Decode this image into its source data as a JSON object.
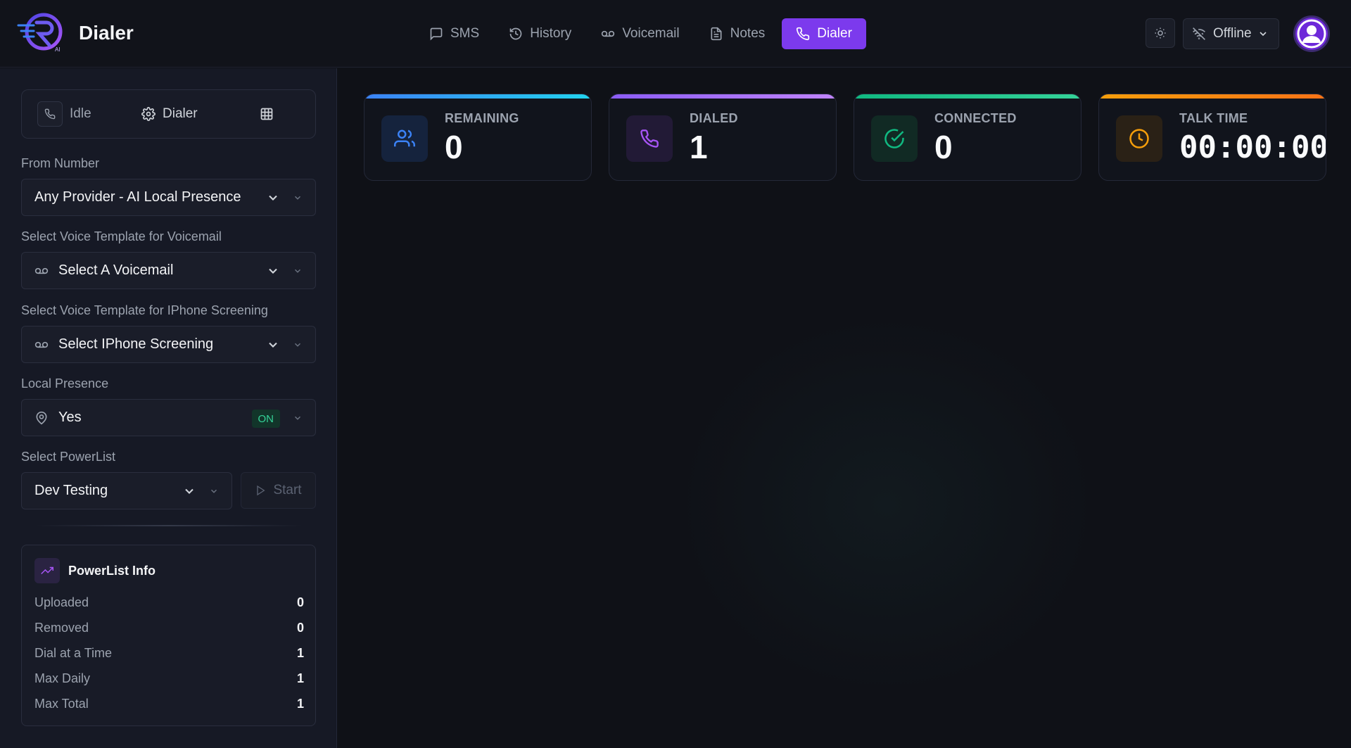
{
  "app": {
    "title": "Dialer",
    "accent": "#7c3aed"
  },
  "nav": {
    "items": [
      {
        "label": "SMS",
        "icon": "message-icon"
      },
      {
        "label": "History",
        "icon": "history-icon"
      },
      {
        "label": "Voicemail",
        "icon": "voicemail-icon"
      },
      {
        "label": "Notes",
        "icon": "file-text-icon"
      },
      {
        "label": "Dialer",
        "icon": "phone-icon",
        "active": true
      }
    ]
  },
  "header": {
    "status_label": "Offline",
    "theme_icon": "sun-icon",
    "status_icon": "wifi-off-icon"
  },
  "sidebar": {
    "modes": {
      "idle_label": "Idle",
      "dialer_label": "Dialer",
      "grid_icon": "grid-icon"
    },
    "from_number": {
      "label": "From Number",
      "value": "Any Provider - AI Local Presence"
    },
    "voicemail_template": {
      "label": "Select Voice Template for Voicemail",
      "value": "Select A Voicemail"
    },
    "iphone_template": {
      "label": "Select Voice Template for IPhone Screening",
      "value": "Select IPhone Screening"
    },
    "local_presence": {
      "label": "Local Presence",
      "value": "Yes",
      "badge": "ON"
    },
    "powerlist": {
      "label": "Select PowerList",
      "value": "Dev Testing",
      "start_label": "Start"
    },
    "powerlist_info": {
      "title": "PowerList Info",
      "rows": [
        {
          "key": "Uploaded",
          "value": "0"
        },
        {
          "key": "Removed",
          "value": "0"
        },
        {
          "key": "Dial at a Time",
          "value": "1"
        },
        {
          "key": "Max Daily",
          "value": "1"
        },
        {
          "key": "Max Total",
          "value": "1"
        }
      ]
    }
  },
  "stats": [
    {
      "label": "REMAINING",
      "value": "0",
      "color": "#3b82f6",
      "icon": "users-icon"
    },
    {
      "label": "DIALED",
      "value": "1",
      "color": "#a855f7",
      "icon": "phone-icon"
    },
    {
      "label": "CONNECTED",
      "value": "0",
      "color": "#10b981",
      "icon": "check-circle-icon"
    },
    {
      "label": "TALK TIME",
      "value": "00:00:00",
      "color": "#f59e0b",
      "icon": "clock-icon"
    }
  ]
}
